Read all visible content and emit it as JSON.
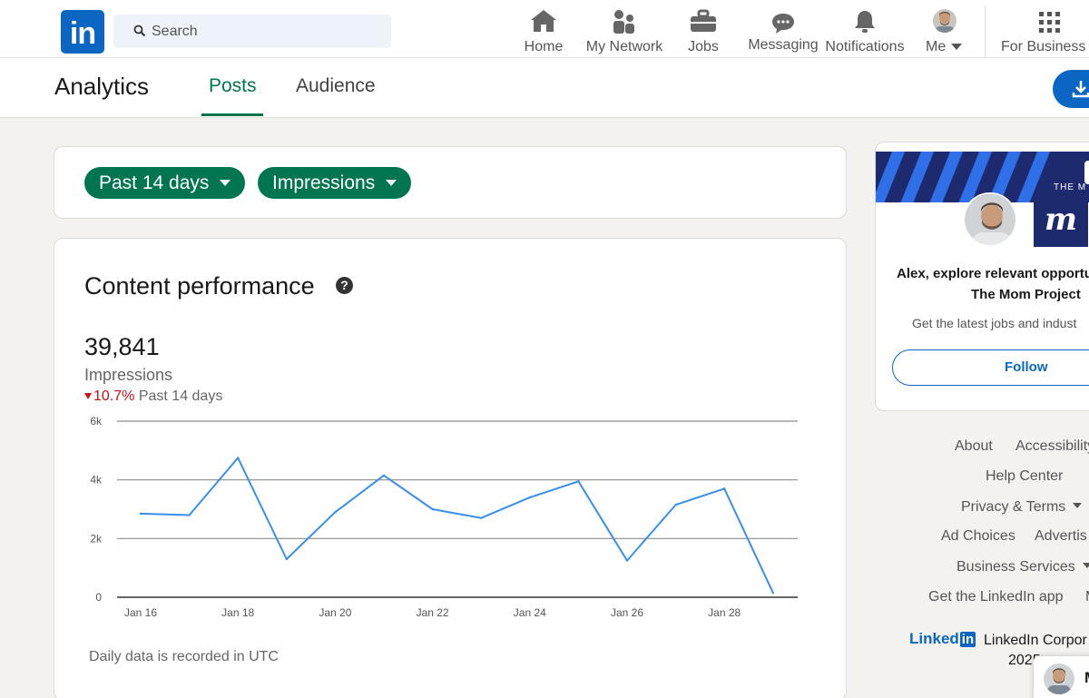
{
  "nav": {
    "search_placeholder": "Search",
    "items": [
      {
        "label": "Home",
        "icon": "home-icon"
      },
      {
        "label": "My Network",
        "icon": "network-icon"
      },
      {
        "label": "Jobs",
        "icon": "briefcase-icon"
      },
      {
        "label": "Messaging",
        "icon": "messaging-icon"
      },
      {
        "label": "Notifications",
        "icon": "bell-icon"
      },
      {
        "label": "Me",
        "icon": "avatar"
      },
      {
        "label": "For Business",
        "icon": "grid-icon"
      }
    ]
  },
  "header": {
    "title": "Analytics",
    "tabs": [
      {
        "label": "Posts",
        "active": true
      },
      {
        "label": "Audience",
        "active": false
      }
    ]
  },
  "filters": {
    "period": "Past 14 days",
    "metric": "Impressions"
  },
  "performance": {
    "title": "Content performance",
    "total": "39,841",
    "metric_label": "Impressions",
    "change": "10.7%",
    "change_period": "Past 14 days",
    "footnote": "Daily data is recorded in UTC"
  },
  "chart_data": {
    "type": "line",
    "title": "",
    "xlabel": "",
    "ylabel": "",
    "ylim": [
      0,
      6000
    ],
    "y_ticks": [
      "0",
      "2k",
      "4k",
      "6k"
    ],
    "x_tick_labels": [
      "Jan 16",
      "Jan 18",
      "Jan 20",
      "Jan 22",
      "Jan 24",
      "Jan 26",
      "Jan 28"
    ],
    "x": [
      "Jan 16",
      "Jan 17",
      "Jan 18",
      "Jan 19",
      "Jan 20",
      "Jan 21",
      "Jan 22",
      "Jan 23",
      "Jan 24",
      "Jan 25",
      "Jan 26",
      "Jan 27",
      "Jan 28",
      "Jan 29"
    ],
    "series": [
      {
        "values": [
          2850,
          2800,
          4750,
          1300,
          2900,
          4150,
          3000,
          2700,
          3400,
          3950,
          1250,
          3150,
          3700,
          150
        ]
      }
    ],
    "grid": true,
    "line_color": "#378fe9"
  },
  "ad": {
    "brand_text": "THE M",
    "logo_letter": "m",
    "headline": "Alex, explore relevant opportu",
    "company": "The Mom Project",
    "description": "Get the latest jobs and indust",
    "follow_label": "Follow"
  },
  "footer": {
    "about": "About",
    "accessibility": "Accessibility",
    "help_center": "Help Center",
    "privacy_terms": "Privacy & Terms",
    "ad_choices": "Ad Choices",
    "advertising": "Advertis",
    "business_services": "Business Services",
    "get_app": "Get the LinkedIn app",
    "get_app_more": "M",
    "brand": "Linked",
    "brand_in": "in",
    "corporation": "LinkedIn Corpor",
    "year": "2025"
  },
  "messaging": {
    "label": "M"
  },
  "colors": {
    "linkedin_blue": "#0a66c2",
    "green_accent": "#01754f",
    "negative_red": "#cc1016",
    "chart_line": "#378fe9"
  }
}
